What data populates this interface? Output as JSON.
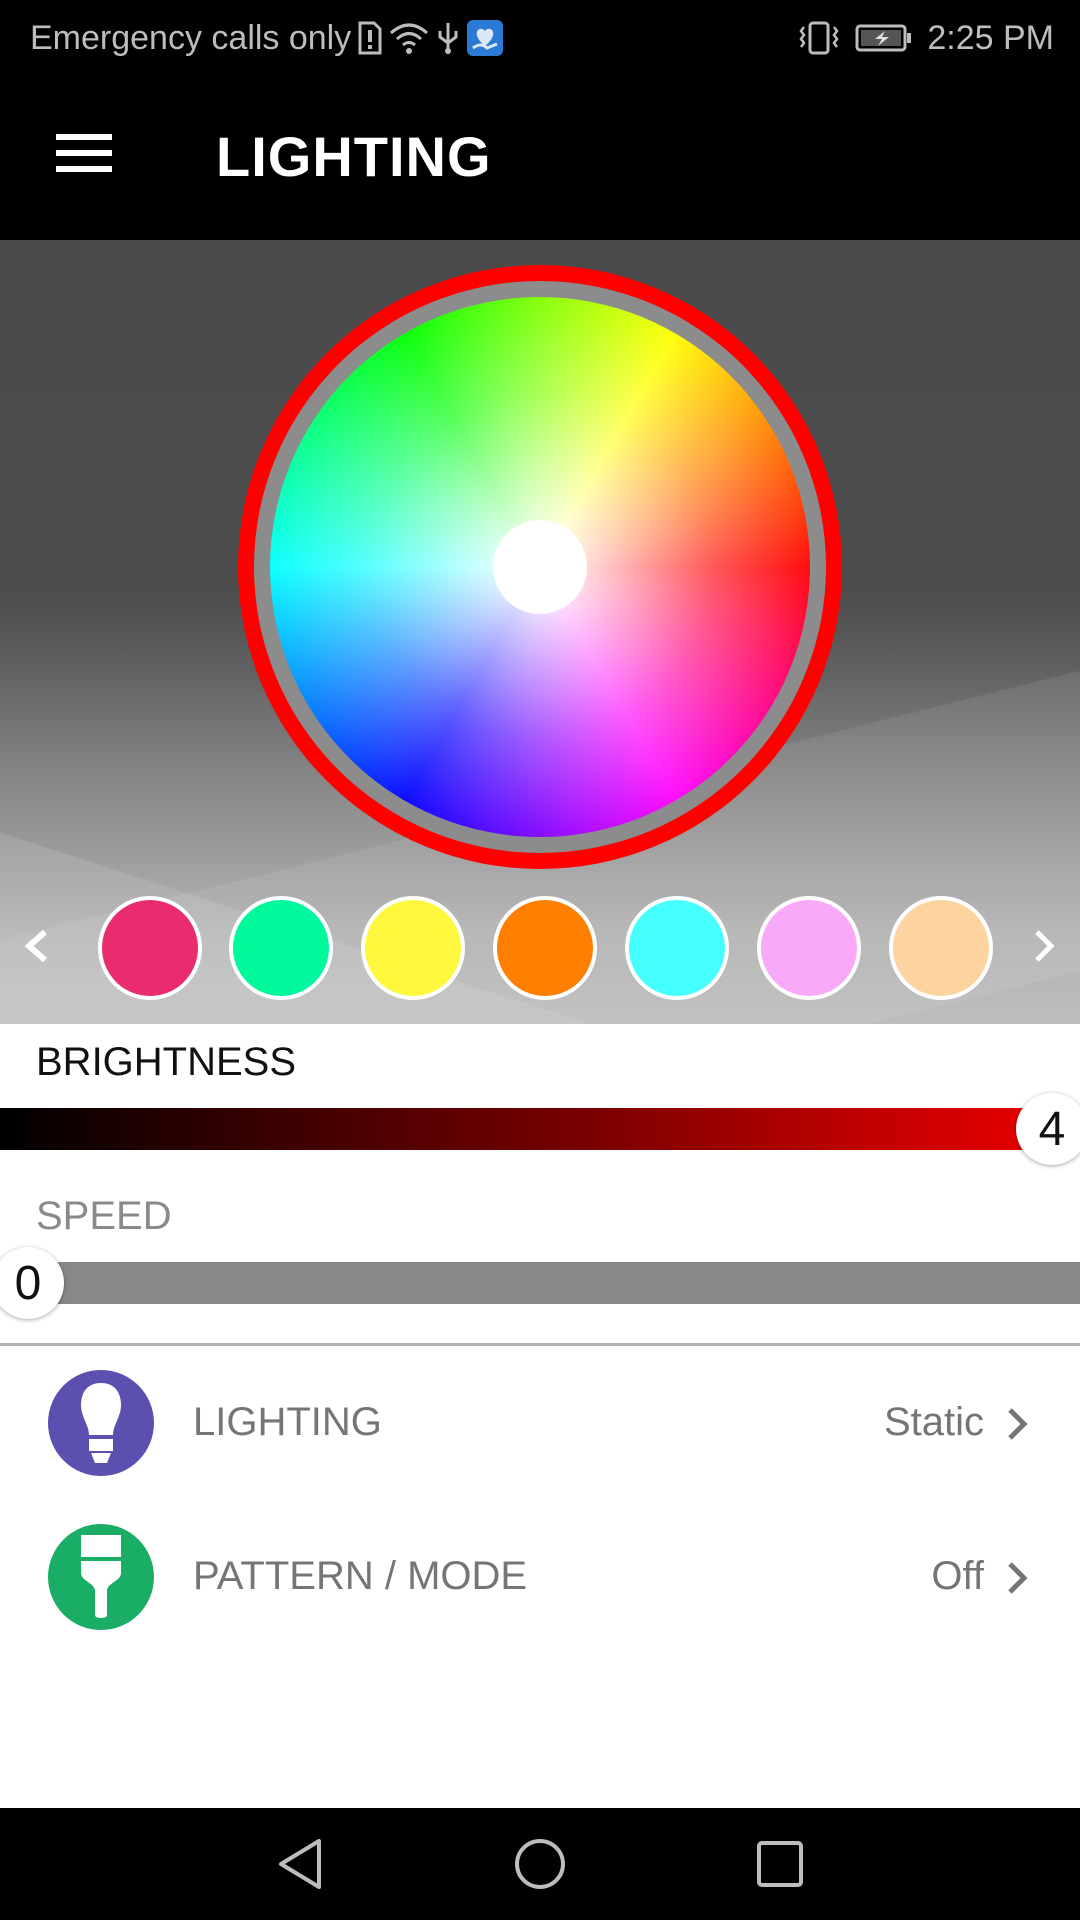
{
  "status_bar": {
    "carrier_text": "Emergency calls only",
    "time": "2:25 PM",
    "icons": [
      "sim-alert-icon",
      "wifi-icon",
      "usb-icon",
      "app-notification-icon",
      "vibrate-icon",
      "battery-charging-icon"
    ]
  },
  "app_bar": {
    "menu_icon": "hamburger-menu-icon",
    "title": "LIGHTING"
  },
  "color_picker": {
    "ring_color": "#ff0000",
    "center_color": "#ffffff",
    "selected_color": "#ff0000"
  },
  "presets": {
    "prev_icon": "chevron-left-icon",
    "next_icon": "chevron-right-icon",
    "swatches": [
      {
        "name": "pink",
        "color": "#e92c6f"
      },
      {
        "name": "green",
        "color": "#00f99c"
      },
      {
        "name": "yellow",
        "color": "#fff83f"
      },
      {
        "name": "orange",
        "color": "#ff8000"
      },
      {
        "name": "cyan",
        "color": "#45ffff"
      },
      {
        "name": "light-pink",
        "color": "#f8a9f8"
      },
      {
        "name": "peach",
        "color": "#fdd49f"
      }
    ]
  },
  "brightness": {
    "label": "BRIGHTNESS",
    "value": "4",
    "fraction": 1.0
  },
  "speed": {
    "label": "SPEED",
    "value": "0",
    "fraction": 0.0
  },
  "menu_rows": [
    {
      "label": "LIGHTING",
      "value": "Static",
      "icon": "light-bulb-icon",
      "icon_color": "#5b4fb0"
    },
    {
      "label": "PATTERN / MODE",
      "value": "Off",
      "icon": "paint-brush-icon",
      "icon_color": "#19ad65"
    }
  ],
  "nav_bar": {
    "back_icon": "back-triangle-icon",
    "home_icon": "home-circle-icon",
    "recents_icon": "recents-square-icon"
  }
}
